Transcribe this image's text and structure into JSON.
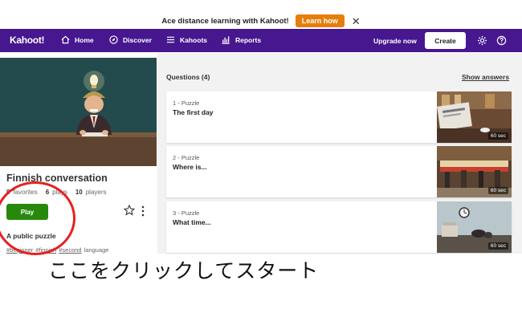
{
  "banner": {
    "text": "Ace distance learning with Kahoot!",
    "button": "Learn how"
  },
  "nav": {
    "logo": "Kahoot!",
    "items": [
      {
        "label": "Home",
        "icon": "home-icon"
      },
      {
        "label": "Discover",
        "icon": "compass-icon"
      },
      {
        "label": "Kahoots",
        "icon": "list-icon"
      },
      {
        "label": "Reports",
        "icon": "bar-chart-icon"
      }
    ],
    "upgrade": "Upgrade now",
    "create": "Create"
  },
  "quiz": {
    "title": "Finnish conversation",
    "stats": [
      {
        "value": "0",
        "label": "favorites"
      },
      {
        "value": "6",
        "label": "plays"
      },
      {
        "value": "10",
        "label": "players"
      }
    ],
    "play": "Play",
    "visibility": "A public puzzle",
    "tags": [
      "#beginner",
      "#finnish",
      "#second"
    ],
    "tags_tail": "language"
  },
  "questions": {
    "header": "Questions (4)",
    "show_answers": "Show answers",
    "items": [
      {
        "type": "1 - Puzzle",
        "title": "The first day",
        "time": "60 sec"
      },
      {
        "type": "2 - Puzzle",
        "title": "Where is...",
        "time": "60 sec"
      },
      {
        "type": "3 - Puzzle",
        "title": "What time...",
        "time": "60 sec"
      }
    ]
  },
  "annotation": {
    "caption": "ここをクリックしてスタート"
  },
  "colors": {
    "brand": "#46178f",
    "play": "#26890c",
    "learn_button": "#e67e0b",
    "annotation": "#e62020"
  }
}
